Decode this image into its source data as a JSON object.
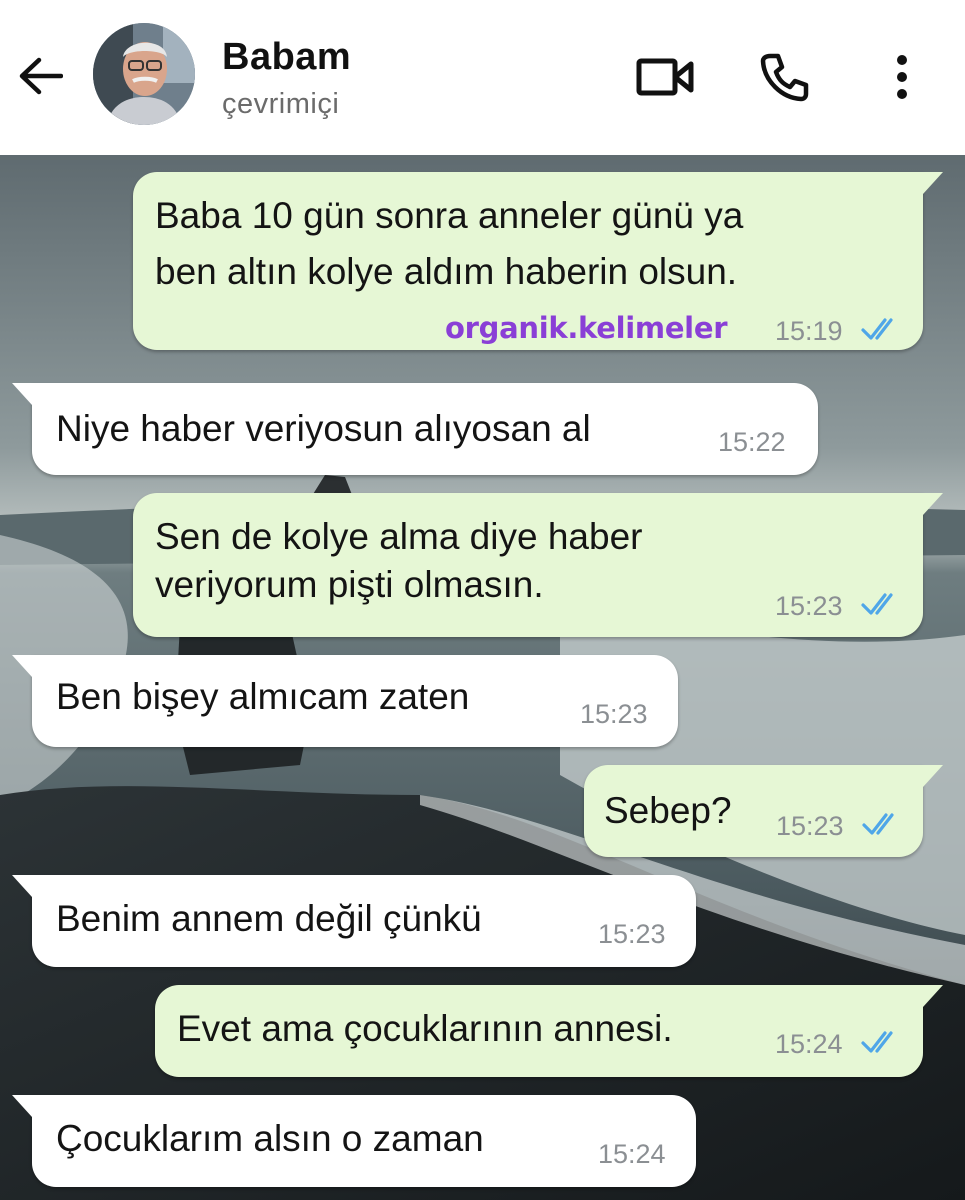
{
  "header": {
    "back_icon": "arrow-left-icon",
    "contact_name": "Babam",
    "contact_status": "çevrimiçi",
    "actions": [
      "video-call-icon",
      "phone-icon",
      "more-vertical-icon"
    ]
  },
  "colors": {
    "outgoing_bubble": "#e6f7d5",
    "incoming_bubble": "#ffffff",
    "read_ticks": "#4fa6e8",
    "watermark": "#8a3fd6"
  },
  "messages": [
    {
      "direction": "out",
      "lines": [
        "Baba 10 gün sonra anneler günü ya",
        "ben altın kolye aldım haberin olsun."
      ],
      "time": "15:19",
      "status": "read"
    },
    {
      "direction": "in",
      "lines": [
        "Niye haber veriyosun alıyosan al"
      ],
      "time": "15:22"
    },
    {
      "direction": "out",
      "lines": [
        "Sen de kolye alma diye haber",
        "veriyorum pişti olmasın."
      ],
      "time": "15:23",
      "status": "read"
    },
    {
      "direction": "in",
      "lines": [
        "Ben bişey almıcam zaten"
      ],
      "time": "15:23"
    },
    {
      "direction": "out",
      "lines": [
        "Sebep?"
      ],
      "time": "15:23",
      "status": "read"
    },
    {
      "direction": "in",
      "lines": [
        "Benim annem değil çünkü"
      ],
      "time": "15:23"
    },
    {
      "direction": "out",
      "lines": [
        "Evet ama çocuklarının annesi."
      ],
      "time": "15:24",
      "status": "read"
    },
    {
      "direction": "in",
      "lines": [
        "Çocuklarım alsın o zaman"
      ],
      "time": "15:24"
    }
  ],
  "watermark": "organik.kelimeler"
}
